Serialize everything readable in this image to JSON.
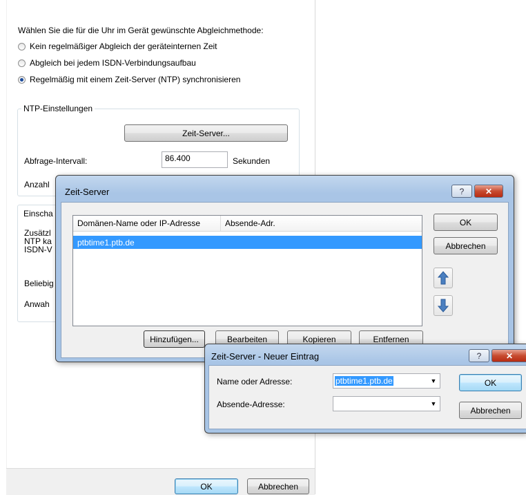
{
  "main": {
    "prompt": "Wählen Sie die für die Uhr im Gerät gewünschte Abgleichmethode:",
    "options": [
      {
        "label": "Kein regelmäßiger Abgleich der geräteinternen Zeit",
        "selected": false
      },
      {
        "label": "Abgleich bei jedem ISDN-Verbindungsaufbau",
        "selected": false
      },
      {
        "label": "Regelmäßig mit einem Zeit-Server (NTP) synchronisieren",
        "selected": true
      }
    ],
    "ntp_group": {
      "title": "NTP-Einstellungen",
      "zeit_server_button": "Zeit-Server...",
      "interval_label": "Abfrage-Intervall:",
      "interval_value": "86.400",
      "interval_unit": "Sekunden",
      "anzahl_label": "Anzahl"
    },
    "second_group": {
      "title_fragment": "Einscha",
      "line1": "Zusätzl",
      "line2": "NTP ka",
      "line3": "ISDN-V",
      "beliebig": "Beliebig",
      "anwah": "Anwah"
    },
    "ok_button": "OK",
    "cancel_button": "Abbrechen"
  },
  "zeit_server_dialog": {
    "title": "Zeit-Server",
    "help_glyph": "?",
    "close_glyph": "✕",
    "columns": [
      "Domänen-Name oder IP-Adresse",
      "Absende-Adr."
    ],
    "rows": [
      {
        "name": "ptbtime1.ptb.de",
        "absende": "",
        "selected": true
      }
    ],
    "ok_button": "OK",
    "cancel_button": "Abbrechen",
    "add_button": "Hinzufügen...",
    "edit_button": "Bearbeiten",
    "copy_button": "Kopieren",
    "remove_button": "Entfernen",
    "colors": {
      "selection": "#3399ff",
      "arrow": "#4a7fc0"
    }
  },
  "new_entry_dialog": {
    "title": "Zeit-Server - Neuer Eintrag",
    "help_glyph": "?",
    "name_label": "Name oder Adresse:",
    "name_value": "ptbtime1.ptb.de",
    "absende_label": "Absende-Adresse:",
    "absende_value": "",
    "ok_button": "OK",
    "cancel_button": "Abbrechen"
  }
}
